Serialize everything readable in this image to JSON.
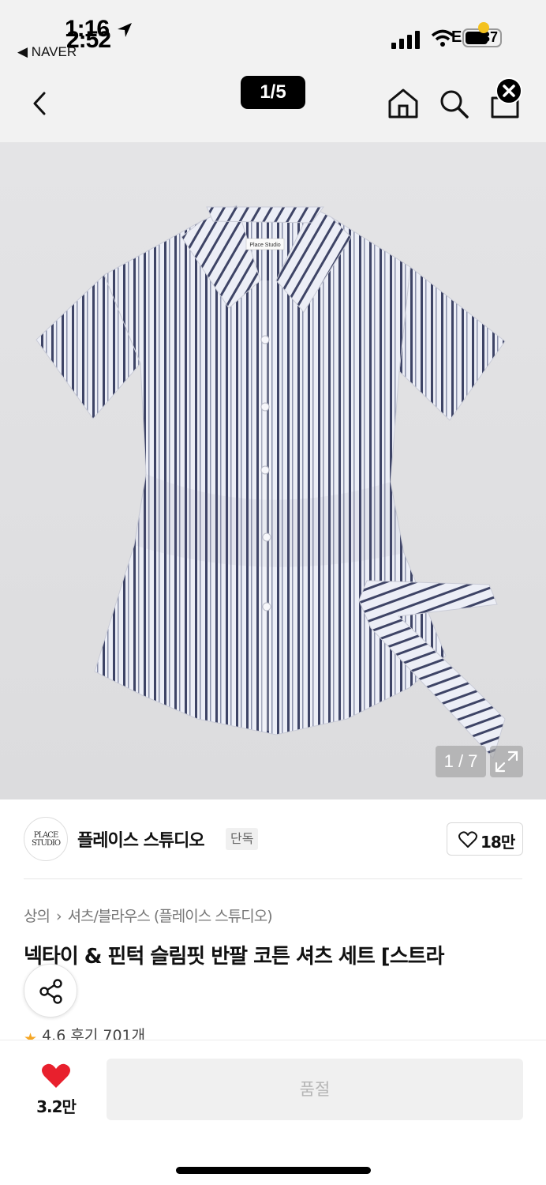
{
  "status_bar": {
    "time_primary": "1:16",
    "time_overlay": "2:52",
    "back_app": "◀ NAVER",
    "carrier": "E",
    "battery": "37"
  },
  "nav": {
    "pager": "1/5"
  },
  "product_image": {
    "counter": "1 / 7",
    "shirt_label": "Place Studio"
  },
  "store": {
    "logo_text": "PLACE STUDIO",
    "name": "플레이스 스튜디오",
    "badge": "단독",
    "favorite_count": "18만"
  },
  "breadcrumb": {
    "items": [
      "상의",
      "셔츠/블라우스 (플레이스 스튜디오)"
    ],
    "separator": "›"
  },
  "product": {
    "title": "넥타이 & 핀턱 슬림핏 반팔 코튼 셔츠 세트 [스트라",
    "rating_text": "4.6 후기 701개"
  },
  "bottom_bar": {
    "like_count": "3.2만",
    "buy_button": "품절"
  },
  "colors": {
    "heart": "#e8202d",
    "star": "#f5a623",
    "stripe": "#3e4466",
    "shirt_base": "#eceef6"
  }
}
